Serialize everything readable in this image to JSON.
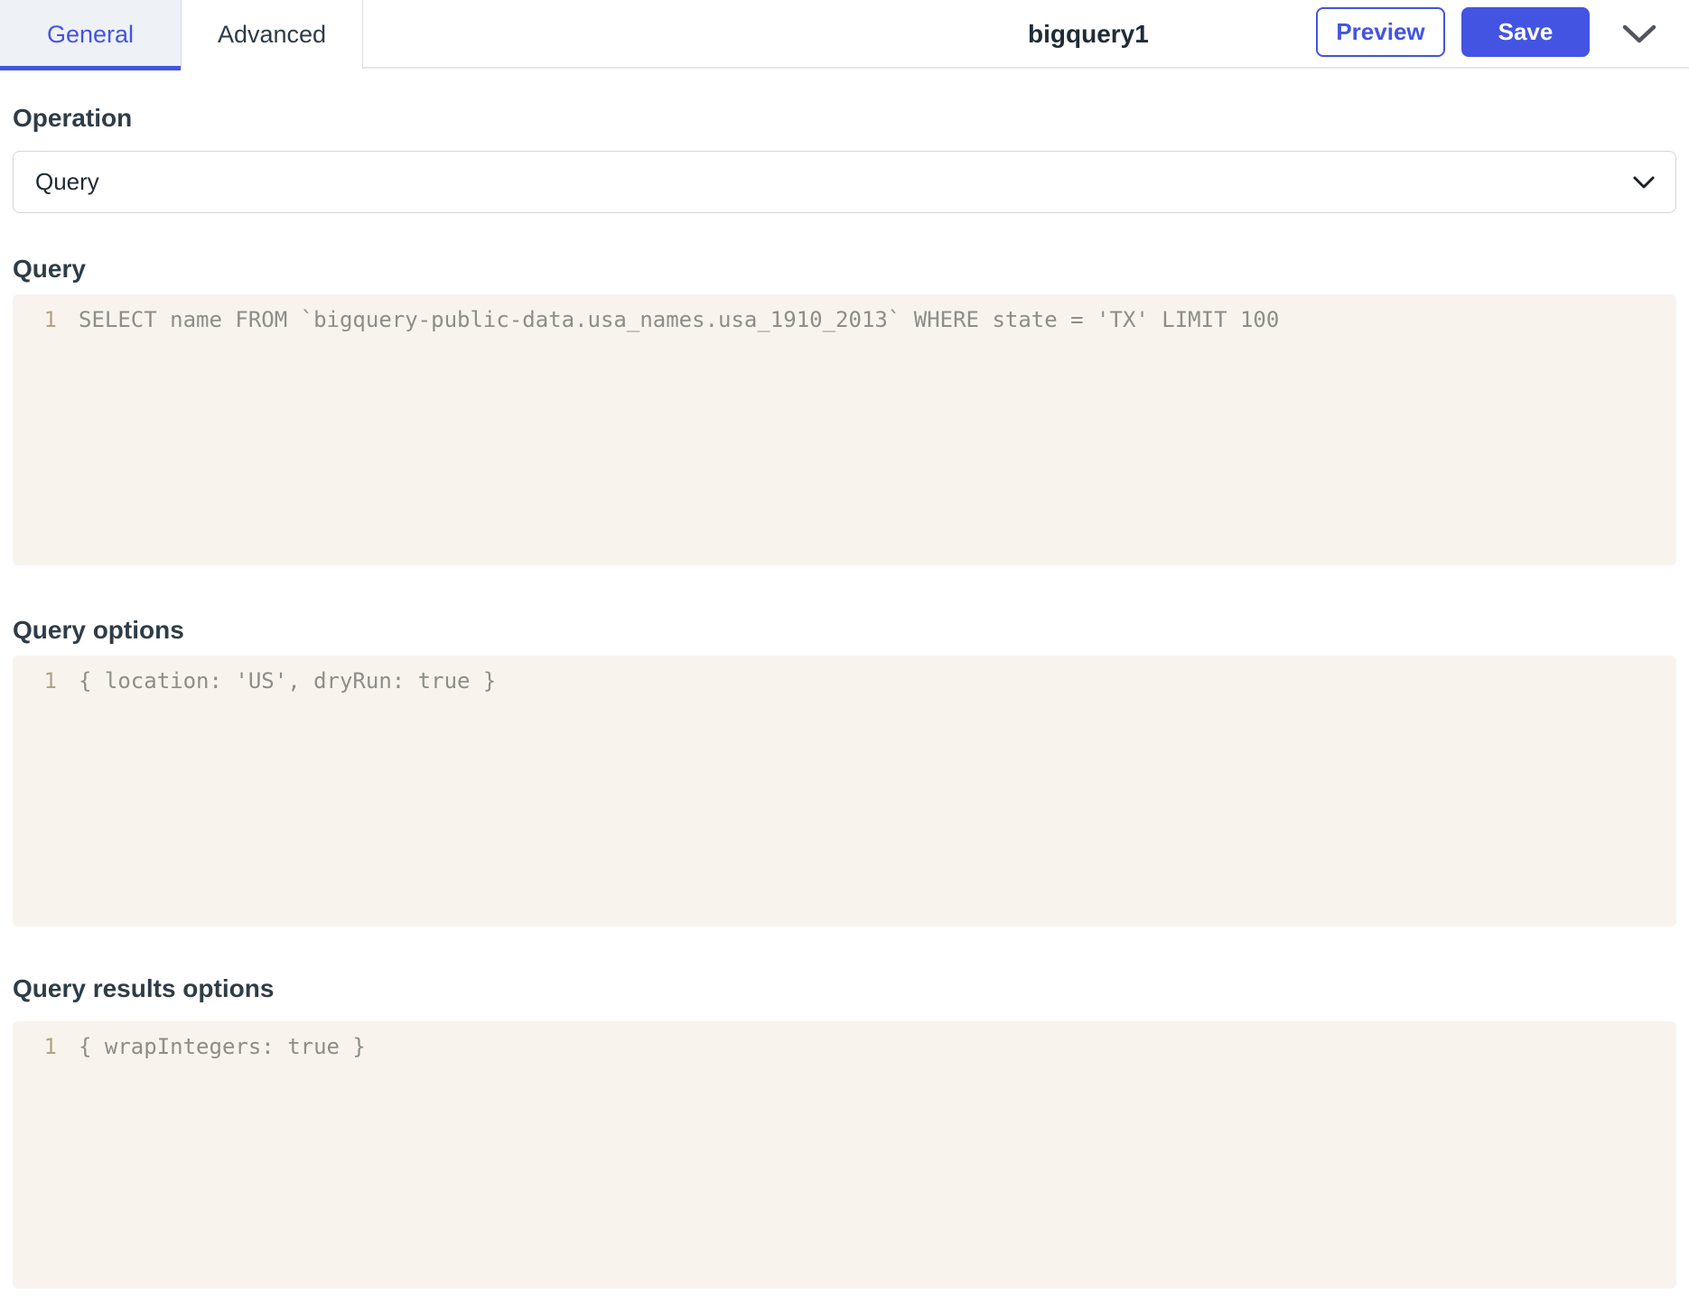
{
  "header": {
    "tabs": [
      {
        "label": "General",
        "active": true
      },
      {
        "label": "Advanced",
        "active": false
      }
    ],
    "title": "bigquery1",
    "buttons": {
      "preview": "Preview",
      "save": "Save"
    }
  },
  "form": {
    "operation": {
      "label": "Operation",
      "value": "Query"
    },
    "query": {
      "label": "Query",
      "line_number": "1",
      "code": "SELECT name FROM `bigquery-public-data.usa_names.usa_1910_2013` WHERE state = 'TX' LIMIT 100"
    },
    "query_options": {
      "label": "Query options",
      "line_number": "1",
      "code": "{ location: 'US', dryRun: true }"
    },
    "query_results_options": {
      "label": "Query results options",
      "line_number": "1",
      "code": "{ wrapIntegers: true }"
    }
  },
  "colors": {
    "accent": "#4354e2",
    "active_tab_bg": "#eef1f6",
    "editor_bg": "#f8f4ed",
    "line_number": "#b3a384",
    "code_text": "#8e8d8a",
    "label_text": "#2e3d47",
    "title_text": "#1f2b38"
  }
}
